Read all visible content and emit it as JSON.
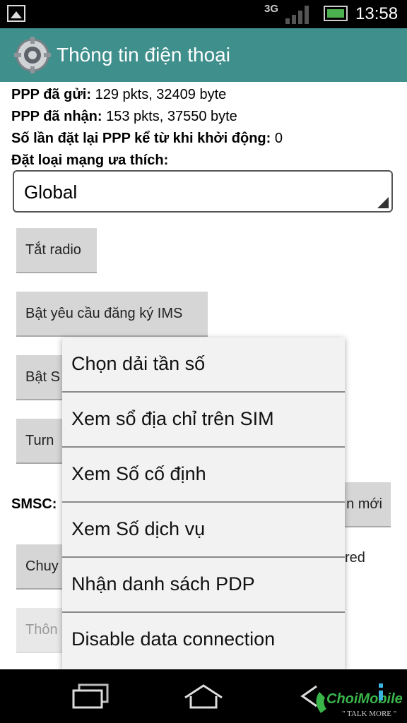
{
  "status_bar": {
    "network": "3G",
    "time": "13:58"
  },
  "app_bar": {
    "title": "Thông tin điện thoại",
    "icon": "gear-icon"
  },
  "info": [
    {
      "label": "PPP đã gửi:",
      "value": " 129 pkts, 32409 byte"
    },
    {
      "label": "PPP đã nhận:",
      "value": " 153 pkts, 37550 byte"
    },
    {
      "label": "Số lần đặt lại PPP kể từ khi khởi động:",
      "value": " 0"
    },
    {
      "label": "Đặt loại mạng ưa thích:",
      "value": ""
    }
  ],
  "spinner": {
    "value": "Global"
  },
  "buttons": {
    "radio": "Tắt radio",
    "ims": "Bật yêu cầu đăng ký IMS",
    "b3": "Bật S",
    "b4": "Turn",
    "update": "n mới",
    "b5": "Chuy",
    "b6": "Thôn"
  },
  "smsc_label": "SMSC:",
  "partial_text": "red",
  "menu": [
    "Chọn dải tần số",
    "Xem sổ địa chỉ trên SIM",
    "Xem Số cố định",
    "Xem Số dịch vụ",
    "Nhận danh sách PDP",
    "Disable data connection"
  ],
  "nav": {
    "recent_icon": "recent-apps-icon",
    "home_icon": "home-icon",
    "back_icon": "back-icon"
  },
  "watermark": {
    "text1": "ChoiMobile",
    "text2": "TALK MORE"
  }
}
